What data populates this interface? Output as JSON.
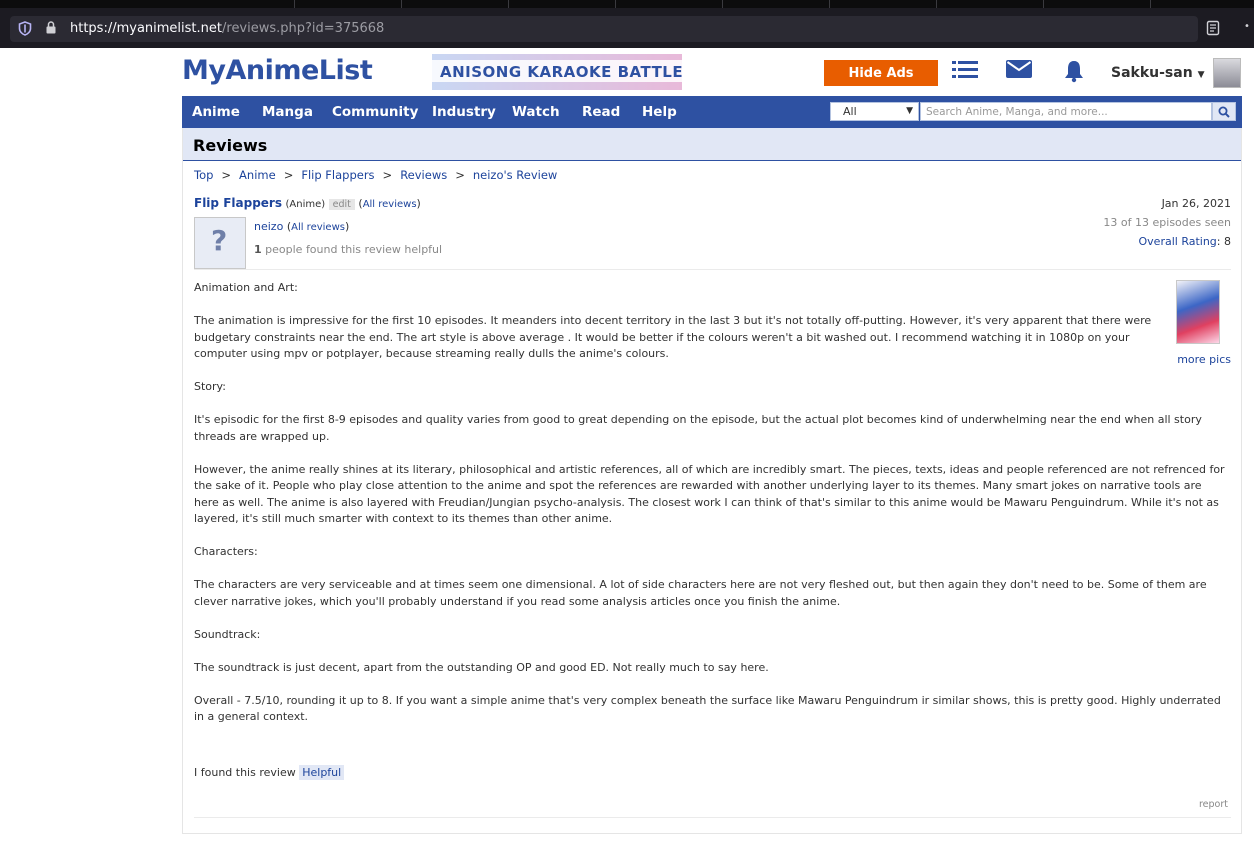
{
  "browser": {
    "url_host": "https://myanimelist.net",
    "url_path": "/reviews.php?id=375668"
  },
  "header": {
    "logo": "MyAnimeList",
    "banner": "ANISONG KARAOKE BATTLE",
    "hide_ads": "Hide Ads",
    "username": "Sakku-san"
  },
  "nav": {
    "items": [
      "Anime",
      "Manga",
      "Community",
      "Industry",
      "Watch",
      "Read",
      "Help"
    ],
    "search_type": "All",
    "search_placeholder": "Search Anime, Manga, and more..."
  },
  "page": {
    "title": "Reviews",
    "breadcrumb": [
      "Top",
      "Anime",
      "Flip Flappers",
      "Reviews",
      "neizo's Review"
    ]
  },
  "review": {
    "anime_title": "Flip Flappers",
    "anime_type": "(Anime)",
    "edit": "edit",
    "all_reviews_anime": "All reviews",
    "reviewer": "neizo",
    "all_reviews_user": "All reviews",
    "helpful_count": "1",
    "helpful_text": "people found this review helpful",
    "date": "Jan 26, 2021",
    "episodes_seen": "13 of 13 episodes seen",
    "overall_rating_label": "Overall Rating",
    "overall_rating": "8",
    "more_pics": "more pics",
    "paragraphs": [
      "Animation and Art:",
      "The animation is impressive for the first 10 episodes. It meanders into decent territory in the last 3 but it's not totally off-putting. However, it's very apparent that there were budgetary constraints near the end. The art style is above average . It would be better if the colours weren't a bit washed out. I recommend watching it in 1080p on your computer using mpv or potplayer, because streaming really dulls the anime's colours.",
      "Story:",
      "It's episodic for the first 8-9 episodes and quality varies from good to great depending on the episode, but the actual plot becomes kind of underwhelming near the end when all story threads are wrapped up.",
      "However, the anime really shines at its literary, philosophical and artistic references, all of which are incredibly smart. The pieces, texts, ideas and people referenced are not refrenced for the sake of it. People who play close attention to the anime and spot the references are rewarded with another underlying layer to its themes. Many smart jokes on narrative tools are here as well. The anime is also layered with Freudian/Jungian psycho-analysis. The closest work I can think of that's similar to this anime would be Mawaru Penguindrum. While it's not as layered, it's still much smarter with context to its themes than other anime.",
      "Characters:",
      "The characters are very serviceable and at times seem one dimensional. A lot of side characters here are not very fleshed out, but then again they don't need to be. Some of them are clever narrative jokes, which you'll probably understand if you read some analysis articles once you finish the anime.",
      "Soundtrack:",
      "The soundtrack is just decent, apart from the outstanding OP and good ED. Not really much to say here.",
      "Overall - 7.5/10, rounding it up to 8. If you want a simple anime that's very complex beneath the surface like Mawaru Penguindrum ir similar shows, this is pretty good. Highly underrated in a general context."
    ],
    "found_text": "I found this review",
    "helpful_button": "Helpful",
    "report": "report"
  },
  "colors": {
    "brand_blue": "#2e51a2",
    "hide_ads_orange": "#e85d00",
    "link_blue": "#1c439b"
  }
}
